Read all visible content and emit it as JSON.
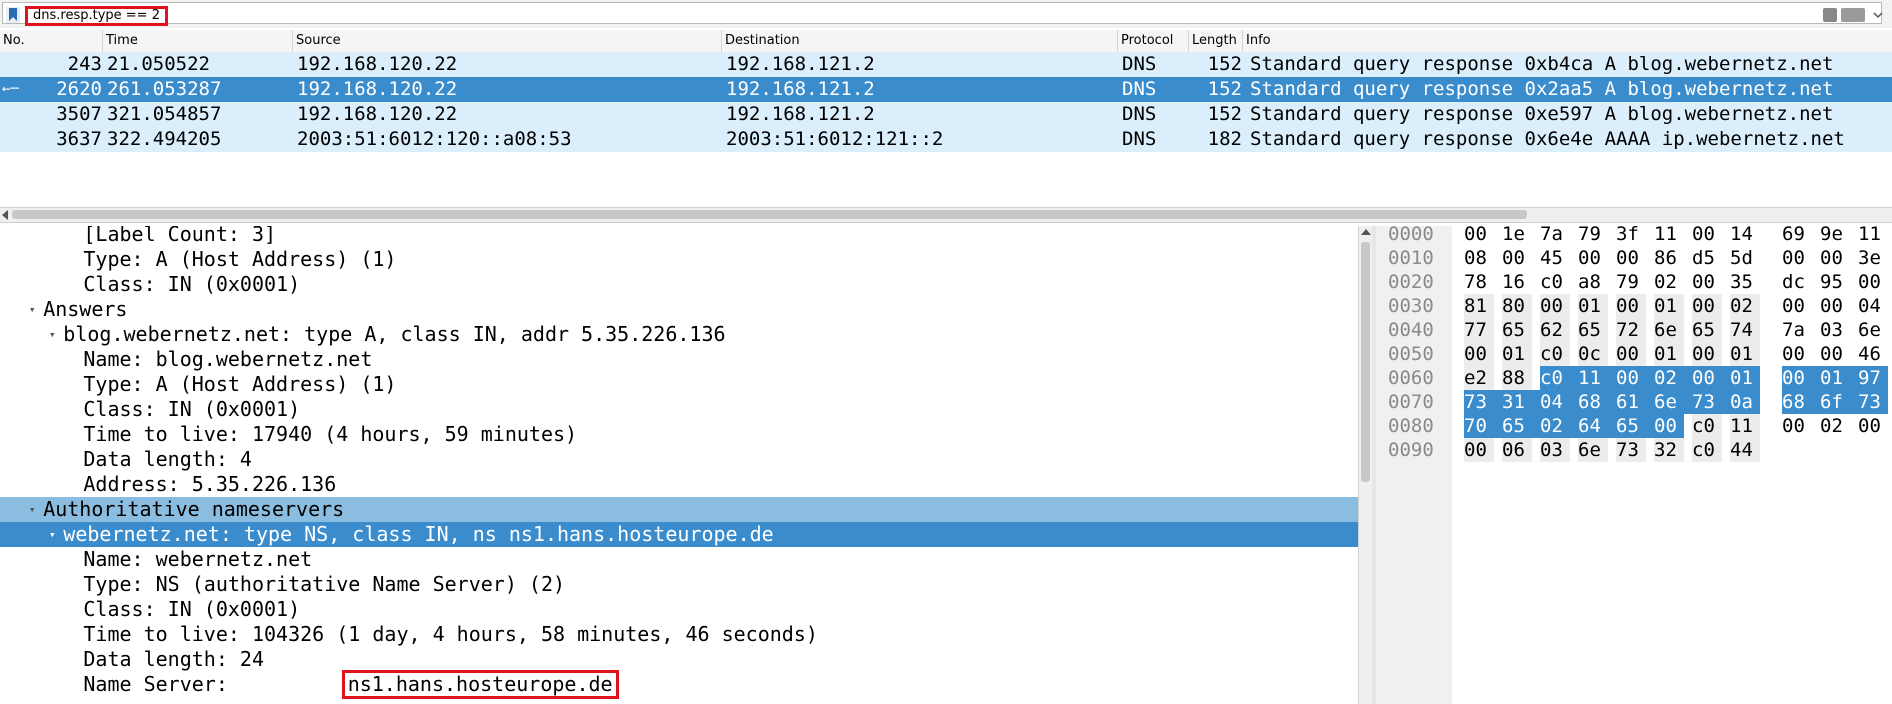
{
  "filter": {
    "text": "dns.resp.type == 2"
  },
  "packet_list": {
    "columns": [
      "No.",
      "Time",
      "Source",
      "Destination",
      "Protocol",
      "Length",
      "Info"
    ],
    "rows": [
      {
        "no": "243",
        "time": "21.050522",
        "src": "192.168.120.22",
        "dst": "192.168.121.2",
        "proto": "DNS",
        "len": "152",
        "info": "Standard query response 0xb4ca A blog.webernetz.net",
        "selected": false
      },
      {
        "no": "2620",
        "time": "261.053287",
        "src": "192.168.120.22",
        "dst": "192.168.121.2",
        "proto": "DNS",
        "len": "152",
        "info": "Standard query response 0x2aa5 A blog.webernetz.net",
        "selected": true
      },
      {
        "no": "3507",
        "time": "321.054857",
        "src": "192.168.120.22",
        "dst": "192.168.121.2",
        "proto": "DNS",
        "len": "152",
        "info": "Standard query response 0xe597 A blog.webernetz.net",
        "selected": false
      },
      {
        "no": "3637",
        "time": "322.494205",
        "src": "2003:51:6012:120::a08:53",
        "dst": "2003:51:6012:121::2",
        "proto": "DNS",
        "len": "182",
        "info": "Standard query response 0x6e4e AAAA ip.webernetz.net",
        "selected": false
      }
    ]
  },
  "detail_tree": {
    "lines": [
      {
        "indent": 4,
        "arrow": "",
        "text": "[Label Count: 3]",
        "state": ""
      },
      {
        "indent": 4,
        "arrow": "",
        "text": "Type: A (Host Address) (1)",
        "state": ""
      },
      {
        "indent": 4,
        "arrow": "",
        "text": "Class: IN (0x0001)",
        "state": ""
      },
      {
        "indent": 2,
        "arrow": "open",
        "text": "Answers",
        "state": ""
      },
      {
        "indent": 3,
        "arrow": "open",
        "text": "blog.webernetz.net: type A, class IN, addr 5.35.226.136",
        "state": ""
      },
      {
        "indent": 4,
        "arrow": "",
        "text": "Name: blog.webernetz.net",
        "state": ""
      },
      {
        "indent": 4,
        "arrow": "",
        "text": "Type: A (Host Address) (1)",
        "state": ""
      },
      {
        "indent": 4,
        "arrow": "",
        "text": "Class: IN (0x0001)",
        "state": ""
      },
      {
        "indent": 4,
        "arrow": "",
        "text": "Time to live: 17940 (4 hours, 59 minutes)",
        "state": ""
      },
      {
        "indent": 4,
        "arrow": "",
        "text": "Data length: 4",
        "state": ""
      },
      {
        "indent": 4,
        "arrow": "",
        "text": "Address: 5.35.226.136",
        "state": ""
      },
      {
        "indent": 2,
        "arrow": "open",
        "text": "Authoritative nameservers",
        "state": "hl"
      },
      {
        "indent": 3,
        "arrow": "open",
        "text": "webernetz.net: type NS, class IN, ns ns1.hans.hosteurope.de",
        "state": "sel"
      },
      {
        "indent": 4,
        "arrow": "",
        "text": "Name: webernetz.net",
        "state": ""
      },
      {
        "indent": 4,
        "arrow": "",
        "text": "Type: NS (authoritative Name Server) (2)",
        "state": ""
      },
      {
        "indent": 4,
        "arrow": "",
        "text": "Class: IN (0x0001)",
        "state": ""
      },
      {
        "indent": 4,
        "arrow": "",
        "text": "Time to live: 104326 (1 day, 4 hours, 58 minutes, 46 seconds)",
        "state": ""
      },
      {
        "indent": 4,
        "arrow": "",
        "text": "Data length: 24",
        "state": ""
      }
    ],
    "name_server_label": "Name Server: ",
    "name_server_value": "ns1.hans.hosteurope.de"
  },
  "hex_dump": {
    "rows": [
      {
        "offset": "0000",
        "bytes": [
          "00",
          "1e",
          "7a",
          "79",
          "3f",
          "11",
          "00",
          "14",
          "69",
          "9e",
          "11"
        ]
      },
      {
        "offset": "0010",
        "bytes": [
          "08",
          "00",
          "45",
          "00",
          "00",
          "86",
          "d5",
          "5d",
          "00",
          "00",
          "3e"
        ]
      },
      {
        "offset": "0020",
        "bytes": [
          "78",
          "16",
          "c0",
          "a8",
          "79",
          "02",
          "00",
          "35",
          "dc",
          "95",
          "00"
        ]
      },
      {
        "offset": "0030",
        "bytes": [
          "81",
          "80",
          "00",
          "01",
          "00",
          "01",
          "00",
          "02",
          "00",
          "00",
          "04"
        ]
      },
      {
        "offset": "0040",
        "bytes": [
          "77",
          "65",
          "62",
          "65",
          "72",
          "6e",
          "65",
          "74",
          "7a",
          "03",
          "6e"
        ]
      },
      {
        "offset": "0050",
        "bytes": [
          "00",
          "01",
          "c0",
          "0c",
          "00",
          "01",
          "00",
          "01",
          "00",
          "00",
          "46"
        ]
      },
      {
        "offset": "0060",
        "bytes": [
          "e2",
          "88",
          "c0",
          "11",
          "00",
          "02",
          "00",
          "01",
          "00",
          "01",
          "97"
        ]
      },
      {
        "offset": "0070",
        "bytes": [
          "73",
          "31",
          "04",
          "68",
          "61",
          "6e",
          "73",
          "0a",
          "68",
          "6f",
          "73"
        ]
      },
      {
        "offset": "0080",
        "bytes": [
          "70",
          "65",
          "02",
          "64",
          "65",
          "00",
          "c0",
          "11",
          "00",
          "02",
          "00"
        ]
      },
      {
        "offset": "0090",
        "bytes": [
          "00",
          "06",
          "03",
          "6e",
          "73",
          "32",
          "c0",
          "44"
        ]
      }
    ],
    "selection": [
      [
        6,
        2,
        10
      ],
      [
        7,
        0,
        10
      ],
      [
        8,
        0,
        5
      ]
    ]
  }
}
